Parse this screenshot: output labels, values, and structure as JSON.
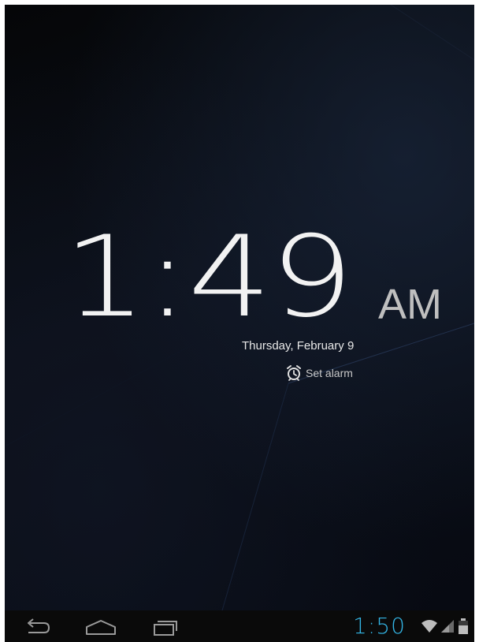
{
  "lockscreen": {
    "time": "1:49",
    "ampm": "AM",
    "date": "Thursday, February 9",
    "alarm_label": "Set alarm",
    "alarm_icon": "alarm-clock-icon"
  },
  "navbar": {
    "buttons": [
      {
        "icon": "back-icon"
      },
      {
        "icon": "home-icon"
      },
      {
        "icon": "recent-apps-icon"
      }
    ]
  },
  "status_bar": {
    "time": "1:50",
    "time_color": "#33b5e5",
    "icons": [
      "wifi-icon",
      "signal-icon",
      "battery-icon"
    ]
  },
  "colors": {
    "background": "#000000",
    "clock_text": "#f2f2f2",
    "ampm_text": "#bfbfbf",
    "accent": "#33b5e5",
    "nav_icon": "#9a9a9a"
  }
}
